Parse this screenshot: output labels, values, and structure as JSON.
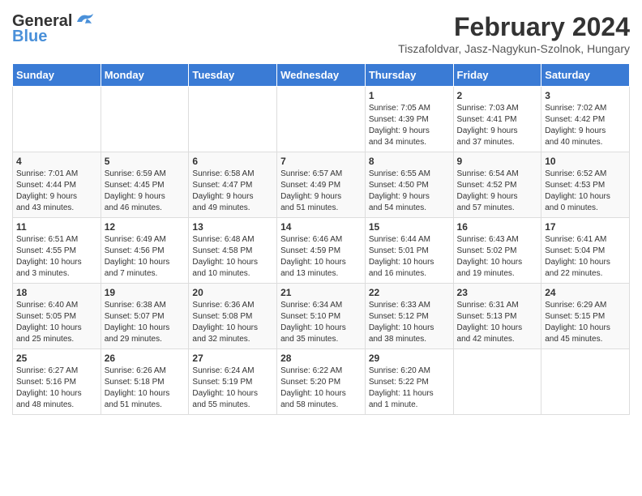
{
  "header": {
    "logo_general": "General",
    "logo_blue": "Blue",
    "month_year": "February 2024",
    "location": "Tiszafoldvar, Jasz-Nagykun-Szolnok, Hungary"
  },
  "weekdays": [
    "Sunday",
    "Monday",
    "Tuesday",
    "Wednesday",
    "Thursday",
    "Friday",
    "Saturday"
  ],
  "weeks": [
    [
      {
        "day": "",
        "info": ""
      },
      {
        "day": "",
        "info": ""
      },
      {
        "day": "",
        "info": ""
      },
      {
        "day": "",
        "info": ""
      },
      {
        "day": "1",
        "info": "Sunrise: 7:05 AM\nSunset: 4:39 PM\nDaylight: 9 hours\nand 34 minutes."
      },
      {
        "day": "2",
        "info": "Sunrise: 7:03 AM\nSunset: 4:41 PM\nDaylight: 9 hours\nand 37 minutes."
      },
      {
        "day": "3",
        "info": "Sunrise: 7:02 AM\nSunset: 4:42 PM\nDaylight: 9 hours\nand 40 minutes."
      }
    ],
    [
      {
        "day": "4",
        "info": "Sunrise: 7:01 AM\nSunset: 4:44 PM\nDaylight: 9 hours\nand 43 minutes."
      },
      {
        "day": "5",
        "info": "Sunrise: 6:59 AM\nSunset: 4:45 PM\nDaylight: 9 hours\nand 46 minutes."
      },
      {
        "day": "6",
        "info": "Sunrise: 6:58 AM\nSunset: 4:47 PM\nDaylight: 9 hours\nand 49 minutes."
      },
      {
        "day": "7",
        "info": "Sunrise: 6:57 AM\nSunset: 4:49 PM\nDaylight: 9 hours\nand 51 minutes."
      },
      {
        "day": "8",
        "info": "Sunrise: 6:55 AM\nSunset: 4:50 PM\nDaylight: 9 hours\nand 54 minutes."
      },
      {
        "day": "9",
        "info": "Sunrise: 6:54 AM\nSunset: 4:52 PM\nDaylight: 9 hours\nand 57 minutes."
      },
      {
        "day": "10",
        "info": "Sunrise: 6:52 AM\nSunset: 4:53 PM\nDaylight: 10 hours\nand 0 minutes."
      }
    ],
    [
      {
        "day": "11",
        "info": "Sunrise: 6:51 AM\nSunset: 4:55 PM\nDaylight: 10 hours\nand 3 minutes."
      },
      {
        "day": "12",
        "info": "Sunrise: 6:49 AM\nSunset: 4:56 PM\nDaylight: 10 hours\nand 7 minutes."
      },
      {
        "day": "13",
        "info": "Sunrise: 6:48 AM\nSunset: 4:58 PM\nDaylight: 10 hours\nand 10 minutes."
      },
      {
        "day": "14",
        "info": "Sunrise: 6:46 AM\nSunset: 4:59 PM\nDaylight: 10 hours\nand 13 minutes."
      },
      {
        "day": "15",
        "info": "Sunrise: 6:44 AM\nSunset: 5:01 PM\nDaylight: 10 hours\nand 16 minutes."
      },
      {
        "day": "16",
        "info": "Sunrise: 6:43 AM\nSunset: 5:02 PM\nDaylight: 10 hours\nand 19 minutes."
      },
      {
        "day": "17",
        "info": "Sunrise: 6:41 AM\nSunset: 5:04 PM\nDaylight: 10 hours\nand 22 minutes."
      }
    ],
    [
      {
        "day": "18",
        "info": "Sunrise: 6:40 AM\nSunset: 5:05 PM\nDaylight: 10 hours\nand 25 minutes."
      },
      {
        "day": "19",
        "info": "Sunrise: 6:38 AM\nSunset: 5:07 PM\nDaylight: 10 hours\nand 29 minutes."
      },
      {
        "day": "20",
        "info": "Sunrise: 6:36 AM\nSunset: 5:08 PM\nDaylight: 10 hours\nand 32 minutes."
      },
      {
        "day": "21",
        "info": "Sunrise: 6:34 AM\nSunset: 5:10 PM\nDaylight: 10 hours\nand 35 minutes."
      },
      {
        "day": "22",
        "info": "Sunrise: 6:33 AM\nSunset: 5:12 PM\nDaylight: 10 hours\nand 38 minutes."
      },
      {
        "day": "23",
        "info": "Sunrise: 6:31 AM\nSunset: 5:13 PM\nDaylight: 10 hours\nand 42 minutes."
      },
      {
        "day": "24",
        "info": "Sunrise: 6:29 AM\nSunset: 5:15 PM\nDaylight: 10 hours\nand 45 minutes."
      }
    ],
    [
      {
        "day": "25",
        "info": "Sunrise: 6:27 AM\nSunset: 5:16 PM\nDaylight: 10 hours\nand 48 minutes."
      },
      {
        "day": "26",
        "info": "Sunrise: 6:26 AM\nSunset: 5:18 PM\nDaylight: 10 hours\nand 51 minutes."
      },
      {
        "day": "27",
        "info": "Sunrise: 6:24 AM\nSunset: 5:19 PM\nDaylight: 10 hours\nand 55 minutes."
      },
      {
        "day": "28",
        "info": "Sunrise: 6:22 AM\nSunset: 5:20 PM\nDaylight: 10 hours\nand 58 minutes."
      },
      {
        "day": "29",
        "info": "Sunrise: 6:20 AM\nSunset: 5:22 PM\nDaylight: 11 hours\nand 1 minute."
      },
      {
        "day": "",
        "info": ""
      },
      {
        "day": "",
        "info": ""
      }
    ]
  ]
}
